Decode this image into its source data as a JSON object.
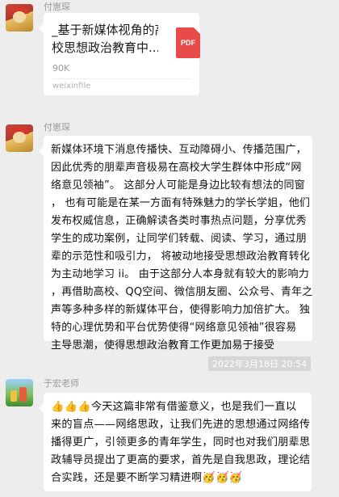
{
  "messages": [
    {
      "sender": "付崽琛",
      "type": "file",
      "file": {
        "title_lines": [
          "_基于新媒体视角的高",
          "校思想政治教育中..."
        ],
        "size": "90K",
        "icon_label": "PDF",
        "icon": "pdf-file-icon",
        "source": "weixinfile"
      }
    },
    {
      "sender": "付崽琛",
      "type": "text",
      "lines": [
        "新媒体环境下消息传播快、互动障碍小、传播范围广，",
        "因此优秀的朋辈声音极易在高校大学生群体中形成“网",
        "络意见领袖”。 这部分人可能是身边比较有想法的同窗",
        "，  也有可能是在某一方面有特殊魅力的学长学姐，他们",
        "发布权威信息，正确解读各类时事热点问题，分享优秀",
        "学生的成功案例，让同学们转载、阅读、学习，通过朋",
        "辈的示范性和吸引力，  将被动地接受思想政治教育转化",
        "为主动地学习 ii。 由于这部分人本身就有较大的影响力",
        "，再借助高校、QQ空间、微信朋友圈、公众号、青年之",
        "声等多种多样的新媒体平台，使得影响力加倍扩大。 独",
        "特的心理优势和平台优势使得“网络意见领袖”很容易",
        "主导思潮，使得思想政治教育工作更加易于接受"
      ]
    },
    {
      "type": "timestamp",
      "text": "2022年3月18日  20:54"
    },
    {
      "sender": "于宏老师",
      "type": "text",
      "lines": [
        "👍👍👍今天这篇非常有借鉴意义，也是我们一直以",
        "来的盲点——网络思政，让我们先进的思想通过网络传",
        "播得更广，引领更多的青年学生，同时也对我们朋辈思",
        "政辅导员提出了更高的要求，首先是自我思政，理论结",
        "合实践，还是要不断学习精进啊🥳🥳🥳"
      ]
    }
  ],
  "colors": {
    "background": "#ededed",
    "bubble": "#ffffff",
    "pdf_icon": "#e94a4a",
    "timestamp_bg": "#d6d6d6",
    "sender_name": "#9a9a9a"
  }
}
